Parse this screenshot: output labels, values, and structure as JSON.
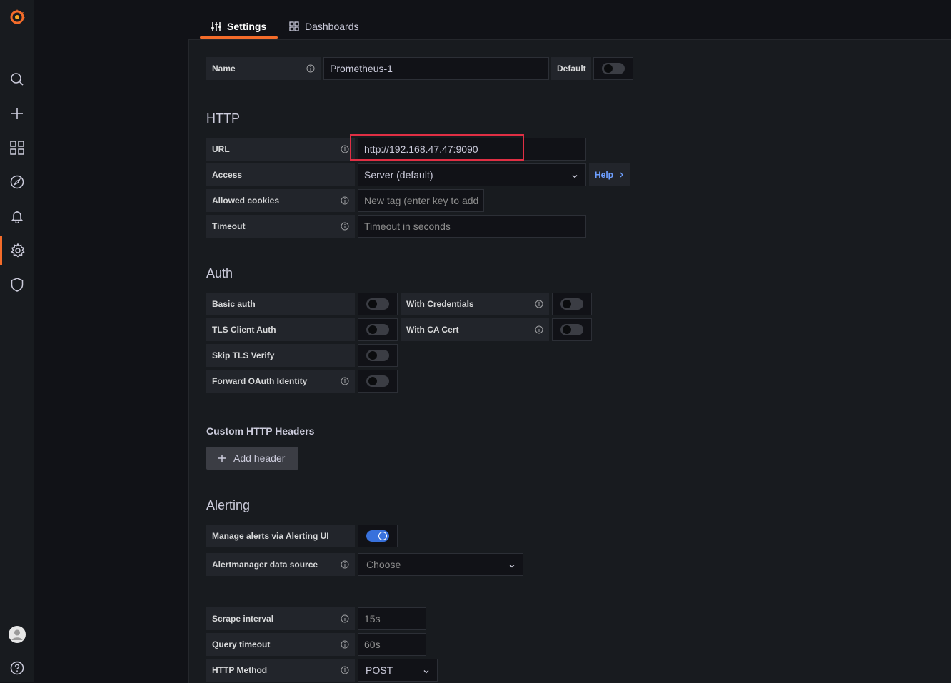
{
  "tabs": [
    {
      "label": "Settings",
      "icon": "sliders-icon",
      "active": true
    },
    {
      "label": "Dashboards",
      "icon": "apps-icon",
      "active": false
    }
  ],
  "name_field": {
    "label": "Name",
    "value": "Prometheus-1",
    "default_label": "Default",
    "default_on": false
  },
  "http": {
    "title": "HTTP",
    "url": {
      "label": "URL",
      "value": "http://192.168.47.47:9090"
    },
    "access": {
      "label": "Access",
      "value": "Server (default)",
      "help": "Help"
    },
    "cookies": {
      "label": "Allowed cookies",
      "placeholder": "New tag (enter key to add"
    },
    "timeout": {
      "label": "Timeout",
      "placeholder": "Timeout in seconds"
    }
  },
  "auth": {
    "title": "Auth",
    "basic": "Basic auth",
    "with_credentials": "With Credentials",
    "tls_client": "TLS Client Auth",
    "with_ca": "With CA Cert",
    "skip_tls": "Skip TLS Verify",
    "forward_oauth": "Forward OAuth Identity"
  },
  "headers": {
    "title": "Custom HTTP Headers",
    "add_button": "Add header"
  },
  "alerting": {
    "title": "Alerting",
    "manage": {
      "label": "Manage alerts via Alerting UI",
      "on": true
    },
    "alertmanager": {
      "label": "Alertmanager data source",
      "placeholder": "Choose"
    }
  },
  "misc": {
    "scrape": {
      "label": "Scrape interval",
      "placeholder": "15s"
    },
    "query_timeout": {
      "label": "Query timeout",
      "placeholder": "60s"
    },
    "method": {
      "label": "HTTP Method",
      "value": "POST"
    }
  },
  "sidemenu": [
    "grafana-logo",
    "search-icon",
    "plus-icon",
    "apps-icon",
    "compass-icon",
    "bell-icon",
    "gear-icon",
    "shield-icon",
    "avatar",
    "help-icon"
  ],
  "colors": {
    "accent": "#f46c2a",
    "primary": "#3871dc",
    "highlight": "#e02f44"
  }
}
